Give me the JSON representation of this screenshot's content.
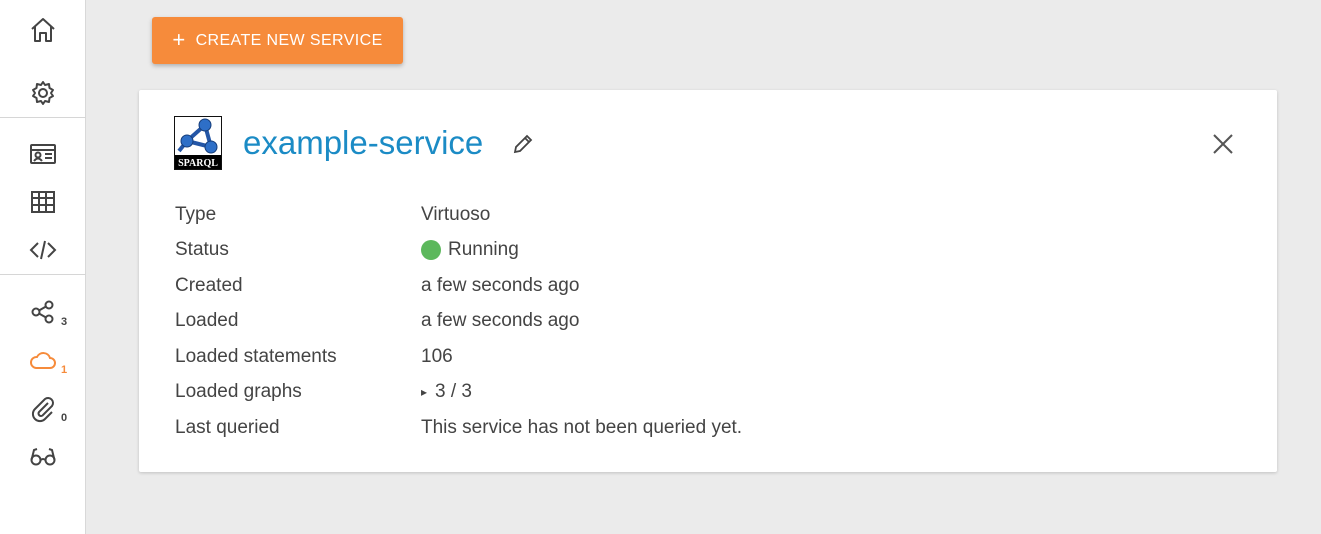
{
  "sidebar": {
    "items": [
      {
        "icon": "home-icon"
      },
      {
        "icon": "gear-icon"
      },
      {
        "icon": "id-card-icon"
      },
      {
        "icon": "table-icon"
      },
      {
        "icon": "code-icon"
      },
      {
        "icon": "share-nodes-icon",
        "count": "3"
      },
      {
        "icon": "cloud-icon",
        "count": "1",
        "active": true
      },
      {
        "icon": "paperclip-icon",
        "count": "0"
      },
      {
        "icon": "glasses-icon"
      }
    ],
    "accent_color": "#f68b3b"
  },
  "toolbar": {
    "create_label": "CREATE NEW SERVICE",
    "create_icon": "+"
  },
  "service": {
    "name": "example-service",
    "logo_text": "SPARQL",
    "details": {
      "type_label": "Type",
      "type_value": "Virtuoso",
      "status_label": "Status",
      "status_value": "Running",
      "status_color": "#5cb85c",
      "created_label": "Created",
      "created_value": "a few seconds ago",
      "loaded_label": "Loaded",
      "loaded_value": "a few seconds ago",
      "statements_label": "Loaded statements",
      "statements_value": "106",
      "graphs_label": "Loaded graphs",
      "graphs_value": "3 / 3",
      "graphs_toggle": "▸",
      "queried_label": "Last queried",
      "queried_value": "This service has not been queried yet."
    }
  },
  "colors": {
    "title": "#1b8bc5",
    "button": "#f68b3b",
    "background": "#ebebeb"
  }
}
